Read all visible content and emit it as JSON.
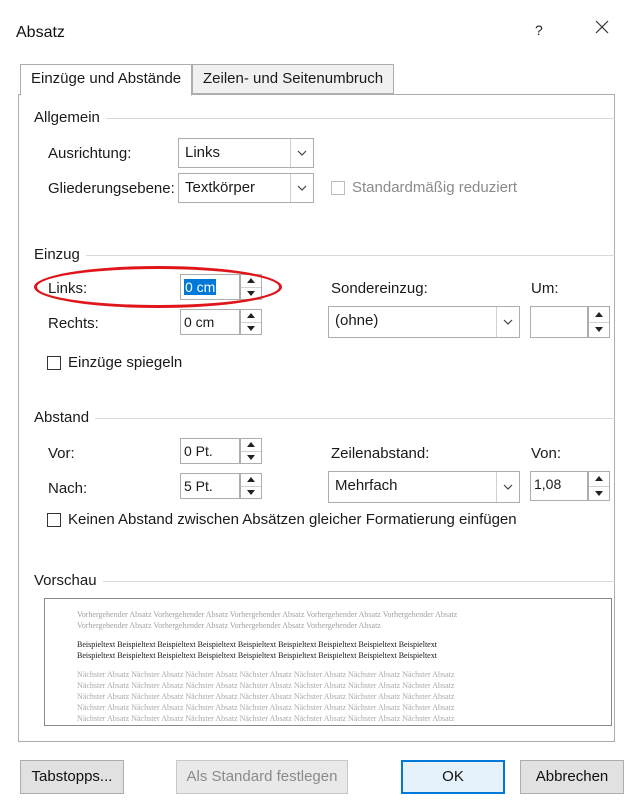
{
  "window": {
    "title": "Absatz",
    "help": "?"
  },
  "tabs": [
    {
      "label": "Einzüge und Abstände",
      "active": true
    },
    {
      "label": "Zeilen- und Seitenumbruch",
      "active": false
    }
  ],
  "general": {
    "group_title": "Allgemein",
    "alignment_label": "Ausrichtung:",
    "alignment_value": "Links",
    "outline_label": "Gliederungsebene:",
    "outline_value": "Textkörper",
    "collapsed_label": "Standardmäßig reduziert"
  },
  "indent": {
    "group_title": "Einzug",
    "left_label": "Links:",
    "left_value": "0 cm",
    "right_label": "Rechts:",
    "right_value": "0 cm",
    "special_label": "Sondereinzug:",
    "special_value": "(ohne)",
    "by_label": "Um:",
    "by_value": "",
    "mirror_label": "Einzüge spiegeln"
  },
  "spacing": {
    "group_title": "Abstand",
    "before_label": "Vor:",
    "before_value": "0 Pt.",
    "after_label": "Nach:",
    "after_value": "5 Pt.",
    "line_label": "Zeilenabstand:",
    "line_value": "Mehrfach",
    "at_label": "Von:",
    "at_value": "1,08",
    "no_space_label": "Keinen Abstand zwischen Absätzen gleicher Formatierung einfügen"
  },
  "preview": {
    "group_title": "Vorschau",
    "previous_lines": [
      "Vorhergehender Absatz Vorhergehender Absatz Vorhergehender Absatz Vorhergehender Absatz Vorhergehender Absatz",
      "Vorhergehender Absatz Vorhergehender Absatz Vorhergehender Absatz Vorhergehender Absatz"
    ],
    "current_lines": [
      "Beispieltext Beispieltext Beispieltext Beispieltext Beispieltext Beispieltext Beispieltext Beispieltext Beispieltext",
      "Beispieltext Beispieltext Beispieltext Beispieltext Beispieltext Beispieltext Beispieltext Beispieltext Beispieltext"
    ],
    "next_lines": [
      "Nächster Absatz Nächster Absatz Nächster Absatz Nächster Absatz Nächster Absatz Nächster Absatz Nächster Absatz",
      "Nächster Absatz Nächster Absatz Nächster Absatz Nächster Absatz Nächster Absatz Nächster Absatz Nächster Absatz",
      "Nächster Absatz Nächster Absatz Nächster Absatz Nächster Absatz Nächster Absatz Nächster Absatz Nächster Absatz",
      "Nächster Absatz Nächster Absatz Nächster Absatz Nächster Absatz Nächster Absatz Nächster Absatz Nächster Absatz",
      "Nächster Absatz Nächster Absatz Nächster Absatz Nächster Absatz Nächster Absatz Nächster Absatz Nächster Absatz"
    ]
  },
  "buttons": {
    "tabs": "Tabstopps...",
    "set_default": "Als Standard festlegen",
    "ok": "OK",
    "cancel": "Abbrechen"
  },
  "colors": {
    "accent": "#0078d7",
    "highlight_ellipse": "#e0151a"
  }
}
